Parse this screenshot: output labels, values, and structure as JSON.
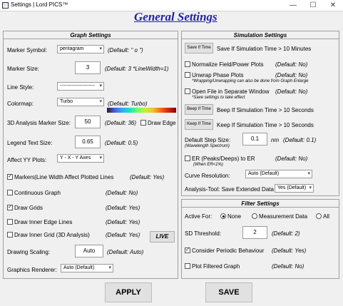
{
  "window": {
    "title": "Settings | Lord PICS™",
    "heading": "General Settings",
    "buttons": {
      "minimize": "—",
      "maximize": "☐",
      "close": "✕"
    }
  },
  "graph": {
    "title": "Graph Settings",
    "marker_symbol": {
      "label": "Marker Symbol:",
      "value": "pentagram",
      "default": "(Default: \" o \")"
    },
    "marker_size": {
      "label": "Marker Size:",
      "value": "3",
      "default": "(Default: 3  *LineWidth=1)"
    },
    "line_style": {
      "label": "Line Style:",
      "value": "---------------------"
    },
    "colormap": {
      "label": "Colormap:",
      "value": "Turbo",
      "default": "(Default: Turbo)"
    },
    "analysis_marker_size": {
      "label": "3D Analysis Marker Size:",
      "value": "50",
      "default": "(Default: 36)"
    },
    "draw_edge": {
      "label": "Draw Edge",
      "checked": false
    },
    "legend_text_size": {
      "label": "Legend Text Size:",
      "value": "0.65",
      "default": "(Default: 0.5)"
    },
    "affect_yy": {
      "label": "Affect YY Plots:",
      "value": "Y - X - Y  Axes"
    },
    "markers_linewidth": {
      "label": "Markers|Line Width Affect Plotted Lines",
      "default": "(Default: Yes)",
      "checked": true
    },
    "continuous_graph": {
      "label": "Continuous Graph",
      "default": "(Default: No)",
      "checked": false
    },
    "draw_grids": {
      "label": "Draw Grids",
      "default": "(Default: Yes)",
      "checked": true
    },
    "draw_inner_edge": {
      "label": "Draw Inner Edge Lines",
      "default": "(Default: Yes)",
      "checked": false
    },
    "draw_inner_grid": {
      "label": "Draw Inner Grid (3D Analysis)",
      "default": "(Default: Yes)",
      "checked": false
    },
    "live_button": "LIVE",
    "drawing_scaling": {
      "label": "Drawing Scaling:",
      "value": "Auto",
      "default": "(Default: Auto)"
    },
    "graphics_renderer": {
      "label": "Graphics Renderer:",
      "value": "Auto (Default)"
    }
  },
  "simulation": {
    "title": "Simulation Settings",
    "save_if_time": {
      "button": "Save If Time",
      "label": "Save If Simulation Time > 10 Minutes"
    },
    "normalize": {
      "label": "Normalize Field/Power Plots",
      "default": "(Default: No)",
      "checked": false
    },
    "unwrap": {
      "label": "Unwrap Phase Plots",
      "default": "(Default: No)",
      "note": "*Wrapping/Unwrapping can also be done from Graph Enlarge",
      "checked": false
    },
    "open_file": {
      "label": "Open File in Separate Window",
      "default": "(Default: No)",
      "note": "*Save settings to take effect",
      "checked": false
    },
    "beep_if_time": {
      "button": "Beep If Time",
      "label": "Beep If Simulation Time > 10 Seconds"
    },
    "keep_if_time": {
      "button": "Keep If Time",
      "label": "Keep If Simulation Time > 10 Seconds"
    },
    "step_size": {
      "label": "Default Step Size:",
      "note": "(Wavelength Spectrum)",
      "value": "0.1",
      "unit": "nm",
      "default": "(Default: 0.1)"
    },
    "er": {
      "label": "ER (Peaks/Deeps) to ER",
      "note": "(When ER<1%)",
      "default": "(Default: No)",
      "checked": false
    },
    "curve_resolution": {
      "label": "Curve Resolution:",
      "value": "Auto (Default)"
    },
    "analysis_tool": {
      "label": "Analysis-Tool: Save Extended Data",
      "value": "Yes (Default)"
    }
  },
  "filter": {
    "title": "Filter Settings",
    "active_for": {
      "label": "Active For:",
      "options": [
        "None",
        "Measurement Data",
        "All"
      ],
      "selected": "None"
    },
    "sd_threshold": {
      "label": "SD Threshold:",
      "value": "2",
      "default": "(Default: 2)"
    },
    "periodic": {
      "label": "Consider Periodic Behaviour",
      "default": "(Default: Yes)",
      "checked": true
    },
    "plot_filtered": {
      "label": "Plot Filtered Graph",
      "default": "(Default: No)",
      "checked": false
    }
  },
  "footer": {
    "apply": "APPLY",
    "save": "SAVE"
  }
}
